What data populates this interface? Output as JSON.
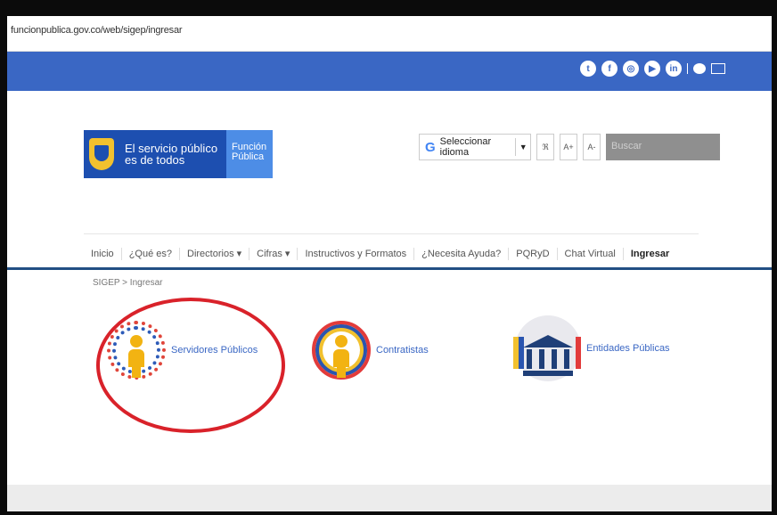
{
  "browser": {
    "url": "funcionpublica.gov.co/web/sigep/ingresar"
  },
  "topbar": {
    "social_icons": [
      "twitter-icon",
      "facebook-icon",
      "instagram-icon",
      "youtube-icon",
      "linkedin-icon",
      "chat-icon",
      "mail-icon"
    ],
    "color": "#3a67c4"
  },
  "logo": {
    "line1": "El servicio público",
    "line2": "es de todos",
    "right_line1": "Función",
    "right_line2": "Pública"
  },
  "tools": {
    "language_label": "Seleccionar idioma",
    "language_arrow": "▼",
    "rss_label": "ℜ",
    "font_increase": "A+",
    "font_decrease": "A-",
    "search_placeholder": "Buscar"
  },
  "nav": {
    "items": [
      "Inicio",
      "¿Qué es?",
      "Directorios ▾",
      "Cifras ▾",
      "Instructivos y Formatos",
      "¿Necesita Ayuda?",
      "PQRyD",
      "Chat Virtual",
      "Ingresar"
    ]
  },
  "breadcrumb": {
    "root": "SIGEP",
    "sep": ">",
    "current": "Ingresar"
  },
  "options": [
    {
      "label": "Servidores Públicos"
    },
    {
      "label": "Contratistas"
    },
    {
      "label": "Entidades Públicas"
    }
  ]
}
